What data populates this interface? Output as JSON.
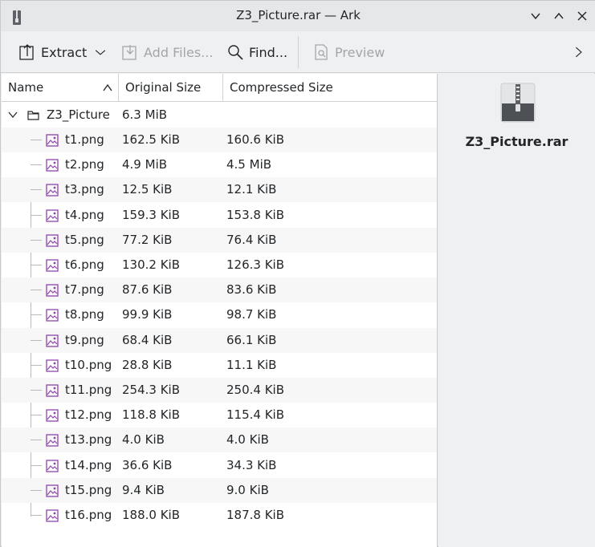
{
  "window": {
    "title": "Z3_Picture.rar — Ark"
  },
  "toolbar": {
    "extract_label": "Extract",
    "add_files_label": "Add Files...",
    "find_label": "Find...",
    "preview_label": "Preview"
  },
  "columns": {
    "name": "Name",
    "original_size": "Original Size",
    "compressed_size": "Compressed Size"
  },
  "folder": {
    "name": "Z3_Picture",
    "original_size": "6.3 MiB",
    "compressed_size": ""
  },
  "files": [
    {
      "name": "t1.png",
      "original_size": "162.5 KiB",
      "compressed_size": "160.6 KiB"
    },
    {
      "name": "t2.png",
      "original_size": "4.9 MiB",
      "compressed_size": "4.5 MiB"
    },
    {
      "name": "t3.png",
      "original_size": "12.5 KiB",
      "compressed_size": "12.1 KiB"
    },
    {
      "name": "t4.png",
      "original_size": "159.3 KiB",
      "compressed_size": "153.8 KiB"
    },
    {
      "name": "t5.png",
      "original_size": "77.2 KiB",
      "compressed_size": "76.4 KiB"
    },
    {
      "name": "t6.png",
      "original_size": "130.2 KiB",
      "compressed_size": "126.3 KiB"
    },
    {
      "name": "t7.png",
      "original_size": "87.6 KiB",
      "compressed_size": "83.6 KiB"
    },
    {
      "name": "t8.png",
      "original_size": "99.9 KiB",
      "compressed_size": "98.7 KiB"
    },
    {
      "name": "t9.png",
      "original_size": "68.4 KiB",
      "compressed_size": "66.1 KiB"
    },
    {
      "name": "t10.png",
      "original_size": "28.8 KiB",
      "compressed_size": "11.1 KiB"
    },
    {
      "name": "t11.png",
      "original_size": "254.3 KiB",
      "compressed_size": "250.4 KiB"
    },
    {
      "name": "t12.png",
      "original_size": "118.8 KiB",
      "compressed_size": "115.4 KiB"
    },
    {
      "name": "t13.png",
      "original_size": "4.0 KiB",
      "compressed_size": "4.0 KiB"
    },
    {
      "name": "t14.png",
      "original_size": "36.6 KiB",
      "compressed_size": "34.3 KiB"
    },
    {
      "name": "t15.png",
      "original_size": "9.4 KiB",
      "compressed_size": "9.0 KiB"
    },
    {
      "name": "t16.png",
      "original_size": "188.0 KiB",
      "compressed_size": "187.8 KiB"
    }
  ],
  "info_panel": {
    "archive_name": "Z3_Picture.rar"
  },
  "colors": {
    "image_icon": "#8e44ad",
    "disabled_text": "#a3a6a9"
  }
}
